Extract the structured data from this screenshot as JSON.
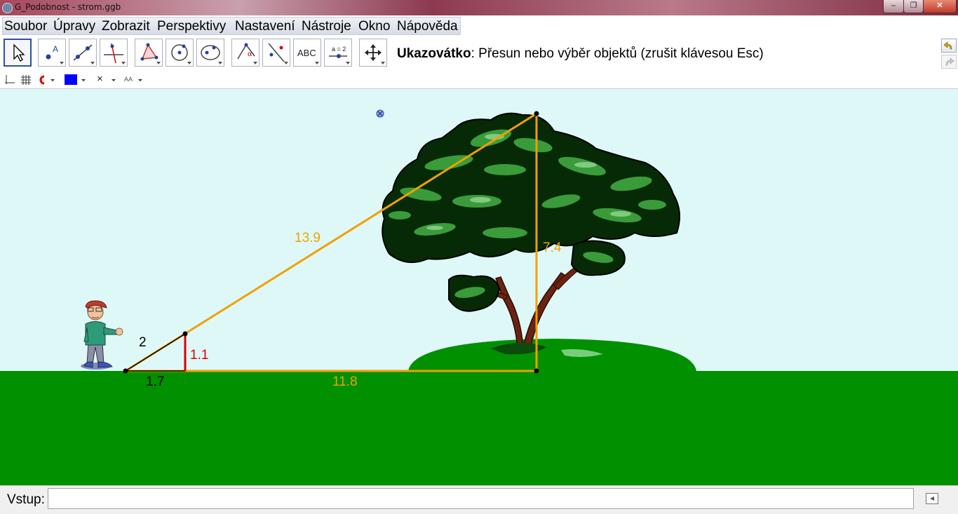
{
  "window": {
    "title": "G_Podobnost - strom.ggb",
    "minimize_glyph": "‒",
    "maximize_glyph": "❐",
    "close_glyph": "✕"
  },
  "menu": [
    "Soubor",
    "Úpravy",
    "Zobrazit",
    "Perspektivy",
    "Nastavení",
    "Nástroje",
    "Okno",
    "Nápověda"
  ],
  "toolbar": {
    "tools": [
      {
        "name": "move-tool",
        "icon": "arrow-pointer-icon",
        "selected": true
      },
      {
        "name": "point-tool",
        "icon": "point-icon"
      },
      {
        "name": "line-tool",
        "icon": "line-icon"
      },
      {
        "name": "perpendicular-line-tool",
        "icon": "perpendicular-icon"
      },
      {
        "name": "polygon-tool",
        "icon": "triangle-icon"
      },
      {
        "name": "circle-center-point-tool",
        "icon": "circle-icon"
      },
      {
        "name": "conic-tool",
        "icon": "ellipse-icon"
      },
      {
        "name": "angle-tool",
        "icon": "angle-icon"
      },
      {
        "name": "reflect-tool",
        "icon": "reflect-icon"
      },
      {
        "name": "text-tool",
        "icon": "text-icon",
        "text": "ABC"
      },
      {
        "name": "slider-tool",
        "icon": "slider-icon",
        "text": "a = 2"
      },
      {
        "name": "move-view-tool",
        "icon": "move-arrows-icon"
      }
    ],
    "hint_bold": "Ukazovátko",
    "hint_text": ": Přesun nebo výběr objektů (zrušit klávesou Esc)"
  },
  "stylebar": {
    "color": "#0000ff",
    "point_style_glyph": "×",
    "font_size_glyph": "AA"
  },
  "graphics": {
    "background": "#def8f8",
    "ground_color": "#009000",
    "big_triangle_color": "#f0a000",
    "small_triangle_side_color": "#dd0000",
    "labels": {
      "hypotenuse_big": "13.9",
      "height_big": "7.4",
      "base_big": "11.8",
      "hypotenuse_small": "2",
      "height_small": "1.1",
      "base_small": "1.7"
    }
  },
  "input": {
    "label": "Vstup:",
    "value": ""
  }
}
